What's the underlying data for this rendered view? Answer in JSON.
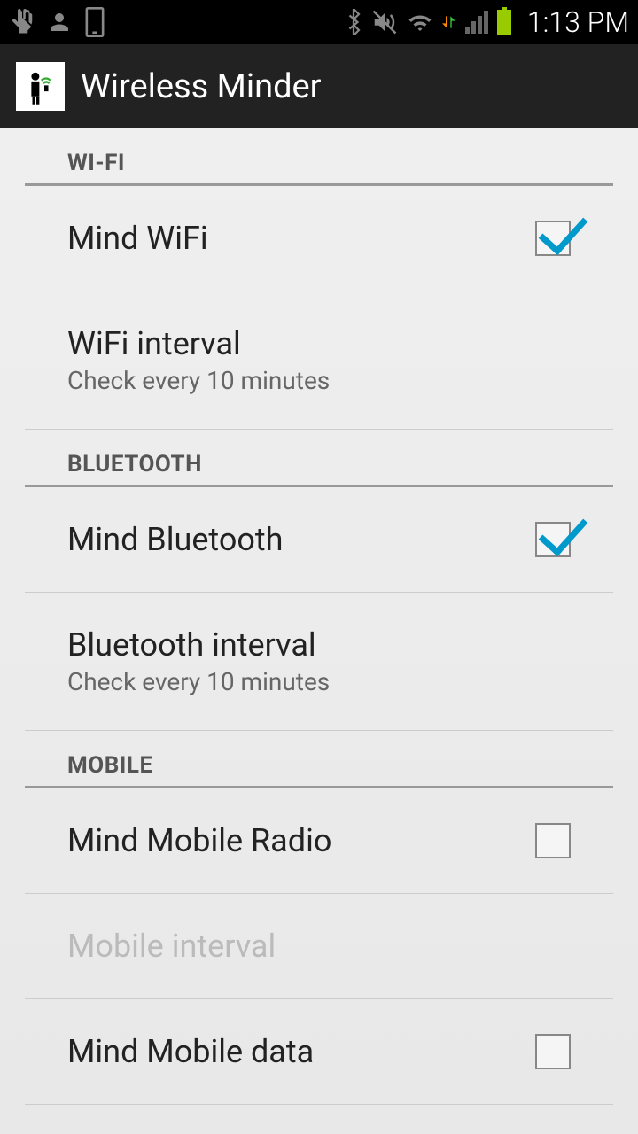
{
  "status": {
    "time": "1:13 PM"
  },
  "app": {
    "title": "Wireless Minder"
  },
  "sections": {
    "wifi": {
      "header": "WI-FI",
      "mind_label": "Mind WiFi",
      "interval_label": "WiFi interval",
      "interval_subtitle": "Check every 10 minutes"
    },
    "bluetooth": {
      "header": "BLUETOOTH",
      "mind_label": "Mind Bluetooth",
      "interval_label": "Bluetooth interval",
      "interval_subtitle": "Check every 10 minutes"
    },
    "mobile": {
      "header": "MOBILE",
      "mind_radio_label": "Mind Mobile Radio",
      "interval_label": "Mobile interval",
      "mind_data_label": "Mind Mobile data"
    }
  }
}
